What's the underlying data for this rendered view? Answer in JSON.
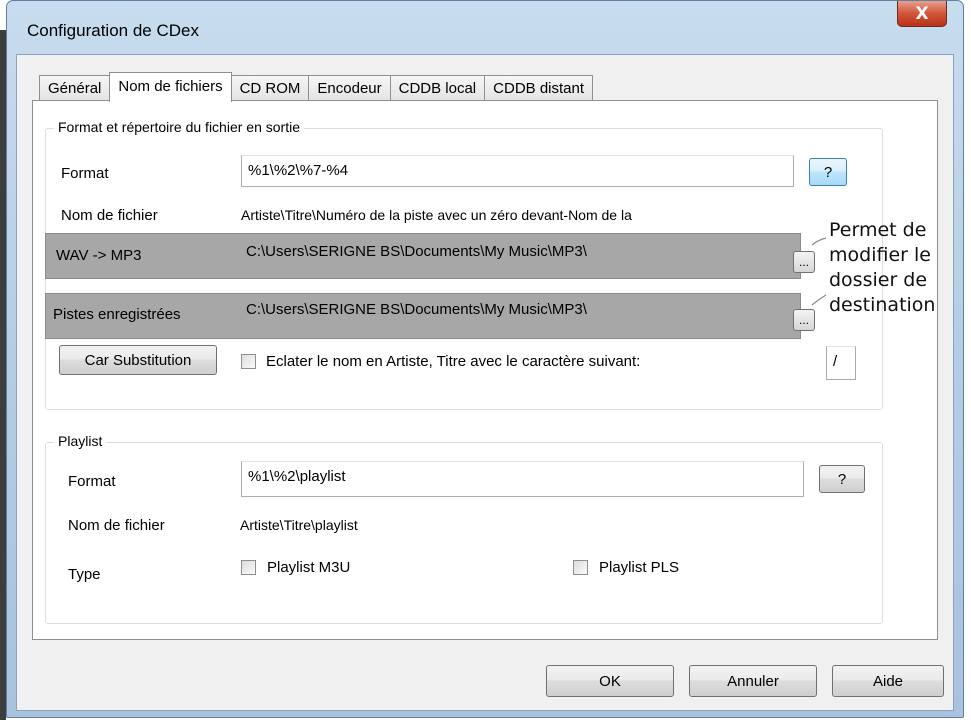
{
  "window": {
    "title": "Configuration de CDex",
    "close_label": "X"
  },
  "tabs": [
    "Général",
    "Nom de fichiers",
    "CD ROM",
    "Encodeur",
    "CDDB local",
    "CDDB distant"
  ],
  "output_group": {
    "title": "Format et répertoire du fichier en sortie",
    "format_label": "Format",
    "format_value": "%1\\%2\\%7-%4",
    "help_label": "?",
    "filename_label": "Nom de fichier",
    "filename_value": "Artiste\\Titre\\Numéro de la piste avec un zéro devant-Nom de la",
    "wav_label": "WAV -> MP3",
    "wav_path": "C:\\Users\\SERIGNE BS\\Documents\\My Music\\MP3\\",
    "tracks_label": "Pistes enregistrées",
    "tracks_path": "C:\\Users\\SERIGNE BS\\Documents\\My Music\\MP3\\",
    "browse_label": "...",
    "substitution_label": "Car Substitution",
    "split_label": "Eclater le nom en Artiste, Titre avec le caractère suivant:",
    "split_char": "/"
  },
  "annotation": {
    "lines": [
      "Permet de",
      "modifier le",
      "dossier de",
      "destination"
    ]
  },
  "playlist_group": {
    "title": "Playlist",
    "format_label": "Format",
    "format_value": "%1\\%2\\playlist",
    "help_label": "?",
    "filename_label": "Nom de fichier",
    "filename_value": "Artiste\\Titre\\playlist",
    "type_label": "Type",
    "m3u_label": "Playlist M3U",
    "pls_label": "Playlist PLS"
  },
  "footer": {
    "ok": "OK",
    "cancel": "Annuler",
    "help": "Aide"
  }
}
